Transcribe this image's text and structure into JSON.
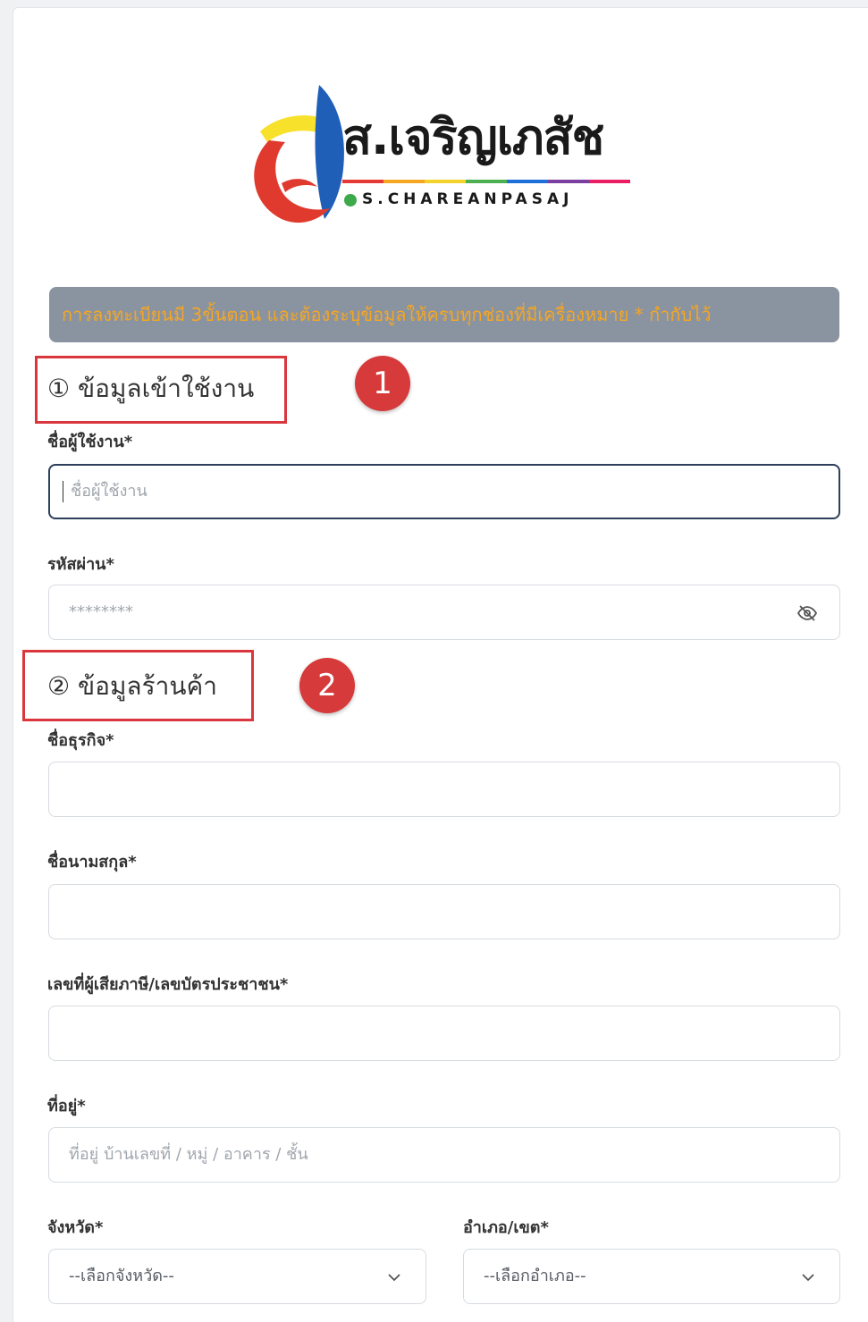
{
  "logo": {
    "wordmark": "ส.เจริญเภสัช",
    "subtitle": "S.CHAREANPASAJ",
    "stripe_colors": [
      "#e53935",
      "#f5a623",
      "#f2d22b",
      "#4caf50",
      "#1e6fd9",
      "#7b3fa0",
      "#e91e63"
    ]
  },
  "notice": {
    "text": "การลงทะเบียนมี 3ขั้นตอน และต้องระบุข้อมูลให้ครบทุกช่องที่มีเครื่องหมาย * กำกับไว้"
  },
  "section1": {
    "title": "① ข้อมูลเข้าใช้งาน",
    "badge": "1",
    "fields": {
      "username": {
        "label": "ชื่อผู้ใช้งาน",
        "placeholder": "ชื่อผู้ใช้งาน"
      },
      "password": {
        "label": "รหัสผ่าน",
        "placeholder": "********"
      }
    }
  },
  "section2": {
    "title": "② ข้อมูลร้านค้า",
    "badge": "2",
    "fields": {
      "business_name": {
        "label": "ชื่อธุรกิจ",
        "placeholder": ""
      },
      "full_name": {
        "label": "ชื่อนามสกุล",
        "placeholder": ""
      },
      "tax_id": {
        "label": "เลขที่ผู้เสียภาษี/เลขบัตรประชาชน",
        "placeholder": ""
      },
      "address": {
        "label": "ที่อยู่",
        "placeholder": "ที่อยู่ บ้านเลขที่ / หมู่ / อาคาร / ชั้น"
      },
      "province": {
        "label": "จังหวัด",
        "value": "--เลือกจังหวัด--"
      },
      "district": {
        "label": "อำเภอ/เขต",
        "value": "--เลือกอำเภอ--"
      }
    }
  },
  "required_mark": "*",
  "colors": {
    "notice_bg": "#8a93a0",
    "notice_text": "#f5a623",
    "highlight": "#d9363e",
    "badge": "#d63a3a",
    "focus_border": "#2d3f5a"
  }
}
